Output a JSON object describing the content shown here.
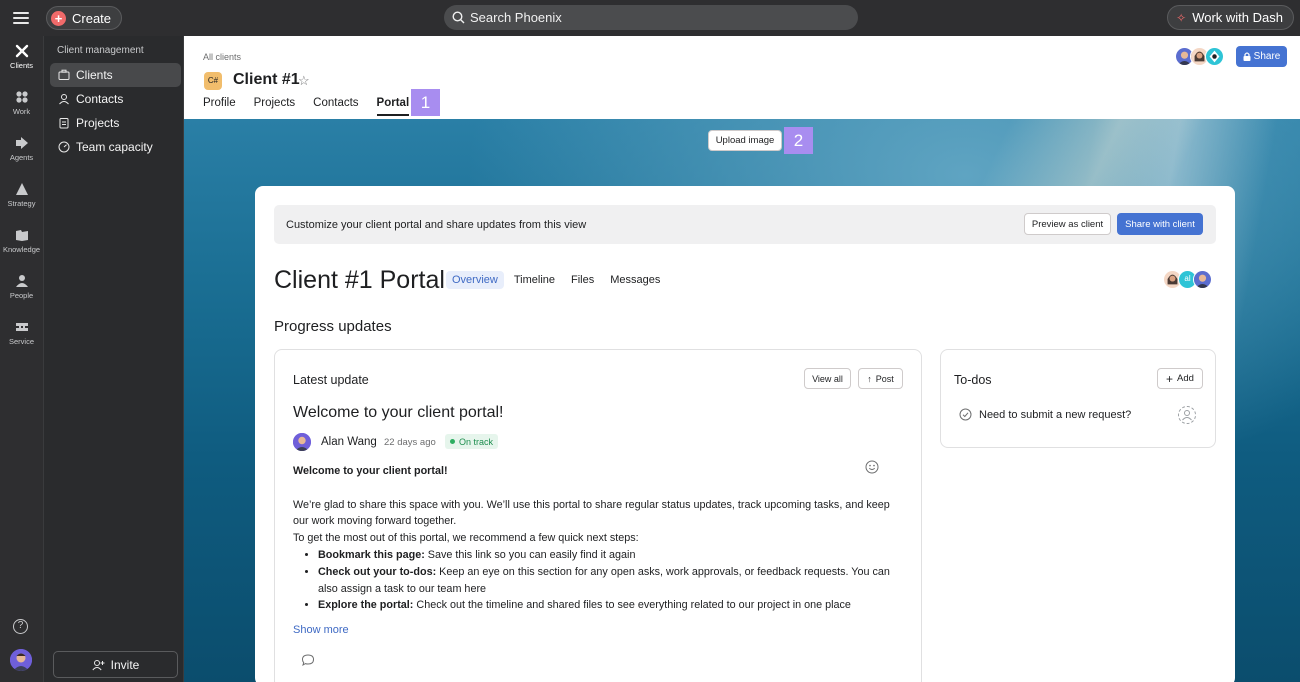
{
  "topbar": {
    "create_label": "Create",
    "search_placeholder": "Search Phoenix",
    "dash_label": "Work with Dash"
  },
  "rail": {
    "items": [
      {
        "label": "Clients",
        "icon": "clients-icon"
      },
      {
        "label": "Work",
        "icon": "work-icon"
      },
      {
        "label": "Agents",
        "icon": "agents-icon"
      },
      {
        "label": "Strategy",
        "icon": "strategy-icon"
      },
      {
        "label": "Knowledge",
        "icon": "knowledge-icon"
      },
      {
        "label": "People",
        "icon": "people-icon"
      },
      {
        "label": "Service",
        "icon": "service-icon"
      }
    ],
    "help_label": "?"
  },
  "sidebar": {
    "title": "Client management",
    "items": [
      {
        "label": "Clients",
        "icon": "briefcase-icon"
      },
      {
        "label": "Contacts",
        "icon": "contact-icon"
      },
      {
        "label": "Projects",
        "icon": "clipboard-icon"
      },
      {
        "label": "Team capacity",
        "icon": "gauge-icon"
      }
    ],
    "invite_label": "Invite"
  },
  "header": {
    "breadcrumb": "All clients",
    "badge": "C#",
    "title": "Client #1",
    "tabs": [
      {
        "label": "Profile"
      },
      {
        "label": "Projects"
      },
      {
        "label": "Contacts"
      },
      {
        "label": "Portal",
        "active": true
      }
    ],
    "marker_1": "1",
    "share_label": "Share"
  },
  "banner": {
    "upload_label": "Upload image",
    "marker_2": "2"
  },
  "portal": {
    "notice": "Customize your client portal and share updates from this view",
    "preview_label": "Preview as client",
    "share_client_label": "Share with client",
    "title": "Client #1 Portal",
    "tabs": [
      {
        "label": "Overview",
        "active": true
      },
      {
        "label": "Timeline"
      },
      {
        "label": "Files"
      },
      {
        "label": "Messages"
      }
    ],
    "avatar_initials": "al",
    "section_title": "Progress updates",
    "update": {
      "label": "Latest update",
      "view_all_label": "View all",
      "post_label": "Post",
      "headline": "Welcome to your client portal!",
      "author": "Alan Wang",
      "ago": "22 days ago",
      "status": "On track",
      "bold_title": "Welcome to your client portal!",
      "para1": "We’re glad to share this space with you. We’ll use this portal to share regular status updates, track upcoming tasks, and keep our work moving forward together.",
      "para2": "To get the most out of this portal, we recommend a few quick next steps:",
      "bullets": [
        {
          "bold": "Bookmark this page:",
          "text": " Save this link so you can easily find it again"
        },
        {
          "bold": "Check out your to-dos:",
          "text": " Keep an eye on this section for any open asks, work approvals, or feedback requests. You can also assign a task to our team here"
        },
        {
          "bold": "Explore the portal:",
          "text": " Check out the timeline and shared files to see everything related to our project in one place"
        }
      ],
      "show_more": "Show more"
    },
    "todos": {
      "title": "To-dos",
      "add_label": "Add",
      "items": [
        {
          "label": "Need to submit a new request?"
        }
      ]
    }
  },
  "colors": {
    "primary_button": "#4573d2",
    "marker": "#a88df0",
    "status_green": "#2dae61",
    "client_badge": "#f1bd6c"
  }
}
